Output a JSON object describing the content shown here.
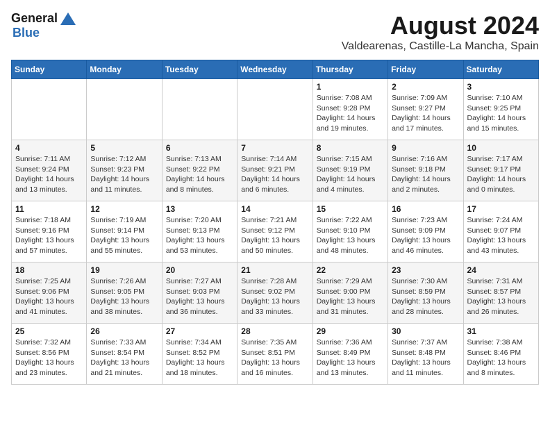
{
  "logo": {
    "general": "General",
    "blue": "Blue"
  },
  "title": "August 2024",
  "subtitle": "Valdearenas, Castille-La Mancha, Spain",
  "weekdays": [
    "Sunday",
    "Monday",
    "Tuesday",
    "Wednesday",
    "Thursday",
    "Friday",
    "Saturday"
  ],
  "weeks": [
    [
      {
        "day": "",
        "info": ""
      },
      {
        "day": "",
        "info": ""
      },
      {
        "day": "",
        "info": ""
      },
      {
        "day": "",
        "info": ""
      },
      {
        "day": "1",
        "info": "Sunrise: 7:08 AM\nSunset: 9:28 PM\nDaylight: 14 hours\nand 19 minutes."
      },
      {
        "day": "2",
        "info": "Sunrise: 7:09 AM\nSunset: 9:27 PM\nDaylight: 14 hours\nand 17 minutes."
      },
      {
        "day": "3",
        "info": "Sunrise: 7:10 AM\nSunset: 9:25 PM\nDaylight: 14 hours\nand 15 minutes."
      }
    ],
    [
      {
        "day": "4",
        "info": "Sunrise: 7:11 AM\nSunset: 9:24 PM\nDaylight: 14 hours\nand 13 minutes."
      },
      {
        "day": "5",
        "info": "Sunrise: 7:12 AM\nSunset: 9:23 PM\nDaylight: 14 hours\nand 11 minutes."
      },
      {
        "day": "6",
        "info": "Sunrise: 7:13 AM\nSunset: 9:22 PM\nDaylight: 14 hours\nand 8 minutes."
      },
      {
        "day": "7",
        "info": "Sunrise: 7:14 AM\nSunset: 9:21 PM\nDaylight: 14 hours\nand 6 minutes."
      },
      {
        "day": "8",
        "info": "Sunrise: 7:15 AM\nSunset: 9:19 PM\nDaylight: 14 hours\nand 4 minutes."
      },
      {
        "day": "9",
        "info": "Sunrise: 7:16 AM\nSunset: 9:18 PM\nDaylight: 14 hours\nand 2 minutes."
      },
      {
        "day": "10",
        "info": "Sunrise: 7:17 AM\nSunset: 9:17 PM\nDaylight: 14 hours\nand 0 minutes."
      }
    ],
    [
      {
        "day": "11",
        "info": "Sunrise: 7:18 AM\nSunset: 9:16 PM\nDaylight: 13 hours\nand 57 minutes."
      },
      {
        "day": "12",
        "info": "Sunrise: 7:19 AM\nSunset: 9:14 PM\nDaylight: 13 hours\nand 55 minutes."
      },
      {
        "day": "13",
        "info": "Sunrise: 7:20 AM\nSunset: 9:13 PM\nDaylight: 13 hours\nand 53 minutes."
      },
      {
        "day": "14",
        "info": "Sunrise: 7:21 AM\nSunset: 9:12 PM\nDaylight: 13 hours\nand 50 minutes."
      },
      {
        "day": "15",
        "info": "Sunrise: 7:22 AM\nSunset: 9:10 PM\nDaylight: 13 hours\nand 48 minutes."
      },
      {
        "day": "16",
        "info": "Sunrise: 7:23 AM\nSunset: 9:09 PM\nDaylight: 13 hours\nand 46 minutes."
      },
      {
        "day": "17",
        "info": "Sunrise: 7:24 AM\nSunset: 9:07 PM\nDaylight: 13 hours\nand 43 minutes."
      }
    ],
    [
      {
        "day": "18",
        "info": "Sunrise: 7:25 AM\nSunset: 9:06 PM\nDaylight: 13 hours\nand 41 minutes."
      },
      {
        "day": "19",
        "info": "Sunrise: 7:26 AM\nSunset: 9:05 PM\nDaylight: 13 hours\nand 38 minutes."
      },
      {
        "day": "20",
        "info": "Sunrise: 7:27 AM\nSunset: 9:03 PM\nDaylight: 13 hours\nand 36 minutes."
      },
      {
        "day": "21",
        "info": "Sunrise: 7:28 AM\nSunset: 9:02 PM\nDaylight: 13 hours\nand 33 minutes."
      },
      {
        "day": "22",
        "info": "Sunrise: 7:29 AM\nSunset: 9:00 PM\nDaylight: 13 hours\nand 31 minutes."
      },
      {
        "day": "23",
        "info": "Sunrise: 7:30 AM\nSunset: 8:59 PM\nDaylight: 13 hours\nand 28 minutes."
      },
      {
        "day": "24",
        "info": "Sunrise: 7:31 AM\nSunset: 8:57 PM\nDaylight: 13 hours\nand 26 minutes."
      }
    ],
    [
      {
        "day": "25",
        "info": "Sunrise: 7:32 AM\nSunset: 8:56 PM\nDaylight: 13 hours\nand 23 minutes."
      },
      {
        "day": "26",
        "info": "Sunrise: 7:33 AM\nSunset: 8:54 PM\nDaylight: 13 hours\nand 21 minutes."
      },
      {
        "day": "27",
        "info": "Sunrise: 7:34 AM\nSunset: 8:52 PM\nDaylight: 13 hours\nand 18 minutes."
      },
      {
        "day": "28",
        "info": "Sunrise: 7:35 AM\nSunset: 8:51 PM\nDaylight: 13 hours\nand 16 minutes."
      },
      {
        "day": "29",
        "info": "Sunrise: 7:36 AM\nSunset: 8:49 PM\nDaylight: 13 hours\nand 13 minutes."
      },
      {
        "day": "30",
        "info": "Sunrise: 7:37 AM\nSunset: 8:48 PM\nDaylight: 13 hours\nand 11 minutes."
      },
      {
        "day": "31",
        "info": "Sunrise: 7:38 AM\nSunset: 8:46 PM\nDaylight: 13 hours\nand 8 minutes."
      }
    ]
  ]
}
